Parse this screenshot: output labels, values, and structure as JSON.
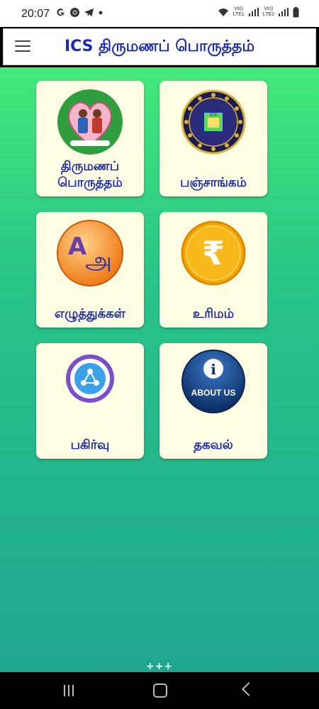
{
  "status_bar": {
    "time": "20:07",
    "icons": [
      "google-icon",
      "chrome-icon",
      "telegram-icon",
      "notification-dot-icon"
    ],
    "wifi_label": "Vo))\nLTE1",
    "sim2_label": "Vo))\nLTE2"
  },
  "app_bar": {
    "title": "ICS திருமணப் பொருத்தம்",
    "menu_icon": "hamburger-menu-icon"
  },
  "tiles": [
    {
      "label": "திருமணப்\nபொருத்தம்",
      "icon": "marriage-couple-icon"
    },
    {
      "label": "பஞ்சாங்கம்",
      "icon": "zodiac-wheel-icon"
    },
    {
      "label": "எழுத்துக்கள்",
      "icon": "letters-a-icon"
    },
    {
      "label": "உரிமம்",
      "icon": "rupee-coin-icon"
    },
    {
      "label": "பகிர்வு",
      "icon": "share-icon"
    },
    {
      "label": "தகவல்",
      "icon": "about-us-info-icon"
    }
  ],
  "about_us_text": "ABOUT US",
  "footer_text": "+++",
  "colors": {
    "title_blue": "#1a2bb0",
    "tile_bg": "#fffde3",
    "gradient_top": "#44e97a",
    "gradient_bottom": "#1fa790"
  }
}
